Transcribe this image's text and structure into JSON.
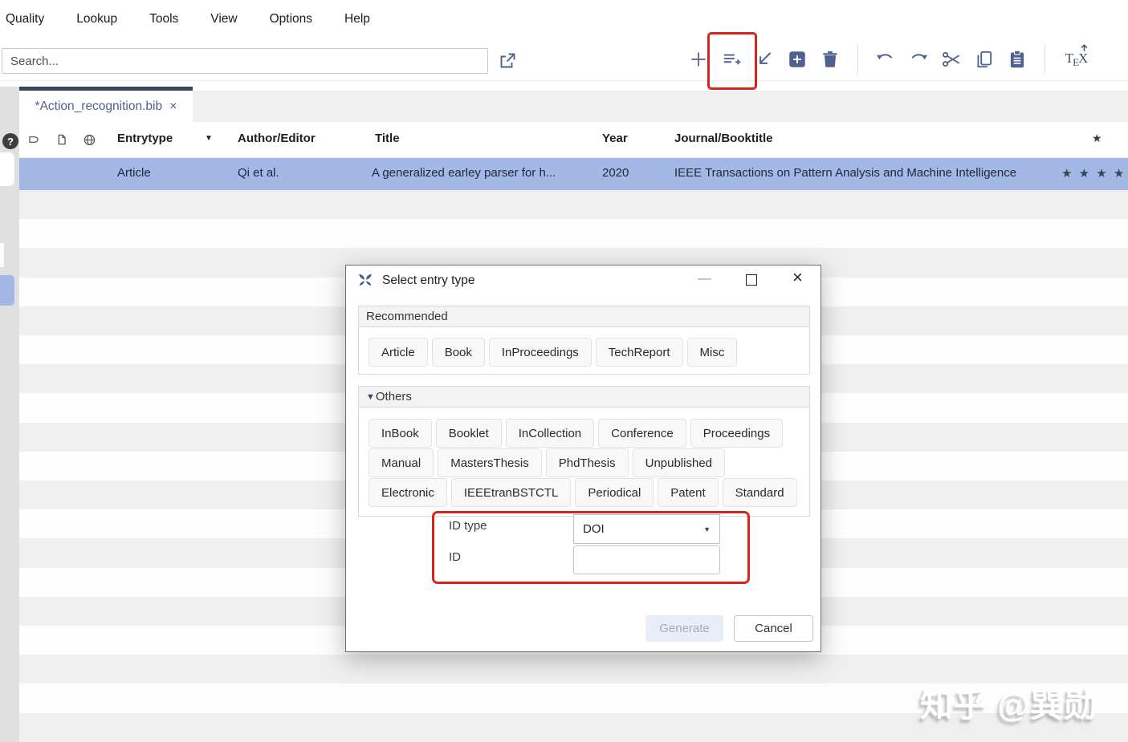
{
  "menu": {
    "items": [
      "Quality",
      "Lookup",
      "Tools",
      "View",
      "Options",
      "Help"
    ]
  },
  "search": {
    "placeholder": "Search..."
  },
  "toolbar": {
    "icons": [
      "new-library",
      "new-entry",
      "import",
      "new-entry-from-plain-text",
      "delete-entry",
      "undo",
      "redo",
      "cut",
      "copy",
      "paste",
      "push-to-tex-editor"
    ],
    "tex_label_t": "T",
    "tex_label_e": "E",
    "tex_label_x": "X"
  },
  "tabs": {
    "active": {
      "label": "*Action_recognition.bib",
      "close_glyph": "×"
    }
  },
  "help_badge": "?",
  "table": {
    "headers": {
      "entrytype": "Entrytype",
      "author_editor": "Author/Editor",
      "title": "Title",
      "year": "Year",
      "journal_booktitle": "Journal/Booktitle",
      "rank_glyph": "★",
      "sort_glyph": "▼"
    },
    "row": {
      "entrytype": "Article",
      "author_editor": "Qi et al.",
      "title": "A generalized earley parser for h...",
      "year": "2020",
      "journal_booktitle": "IEEE Transactions on Pattern Analysis and Machine Intelligence",
      "rank": "★ ★ ★ ★ ★"
    },
    "empty_rows": 19
  },
  "dialog": {
    "title": "Select entry type",
    "window_controls": {
      "minimize": "—",
      "close": "×"
    },
    "recommended": {
      "label": "Recommended",
      "types": [
        "Article",
        "Book",
        "InProceedings",
        "TechReport",
        "Misc"
      ]
    },
    "others": {
      "label": "Others",
      "arrow": "▼",
      "rows": [
        [
          "InBook",
          "Booklet",
          "InCollection",
          "Conference",
          "Proceedings"
        ],
        [
          "Manual",
          "MastersThesis",
          "PhdThesis",
          "Unpublished"
        ],
        [
          "Electronic",
          "IEEEtranBSTCTL",
          "Periodical",
          "Patent",
          "Standard"
        ]
      ]
    },
    "id_form": {
      "id_type_label": "ID type",
      "id_type_value": "DOI",
      "dropdown_glyph": "▼",
      "id_label": "ID",
      "id_value": ""
    },
    "actions": {
      "generate": "Generate",
      "cancel": "Cancel"
    }
  },
  "watermark": "知乎 @巽勋",
  "colors": {
    "accent_navy": "#51618F",
    "tab_border": "#39475E",
    "selected_row": "#A4B8E6",
    "stripe_gray": "#EFEFEF",
    "annotation_red": "#D3271D"
  }
}
